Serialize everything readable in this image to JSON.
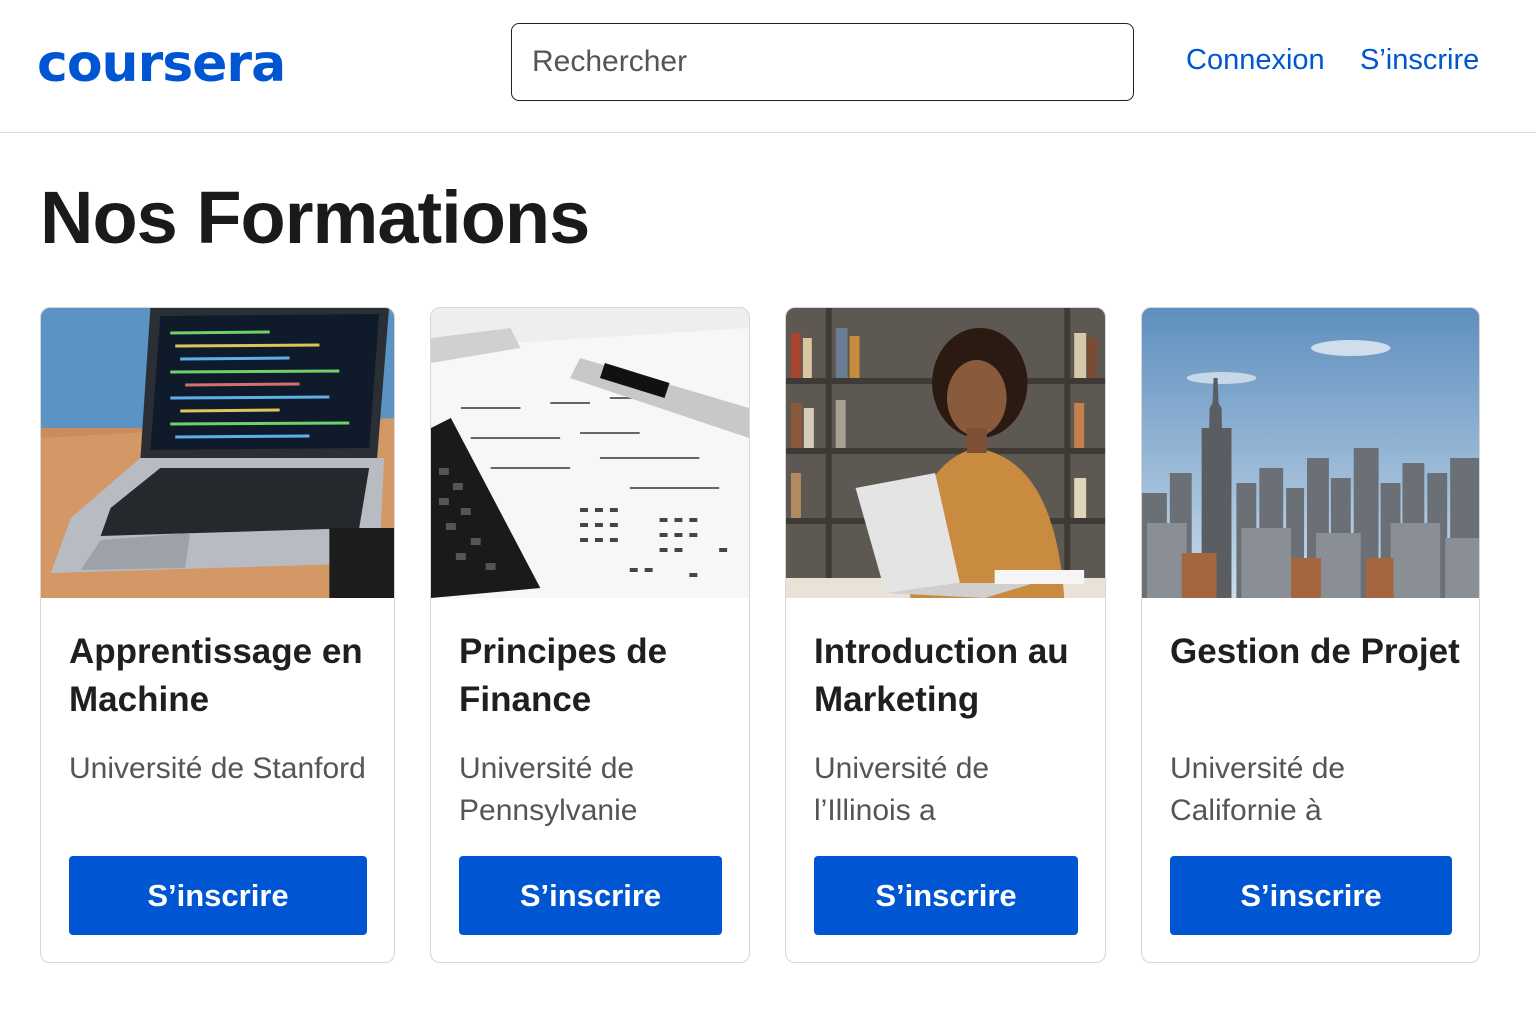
{
  "header": {
    "logo": "coursera",
    "search_placeholder": "Rechercher",
    "login": "Connexion",
    "signup": "S’inscrire"
  },
  "main": {
    "title": "Nos Formations",
    "courses": [
      {
        "title": "Apprentissage en Machine",
        "university": "Université de Stanford",
        "button": "S’inscrire",
        "image": "laptop-code-image"
      },
      {
        "title": "Principes de Finance",
        "university": "Université de Pennsylvanie",
        "button": "S’inscrire",
        "image": "calculator-finance-image"
      },
      {
        "title": "Introduction au Marketing",
        "university": "Université de l’Illinois a",
        "button": "S’inscrire",
        "image": "woman-laptop-image"
      },
      {
        "title": "Gestion de Projet",
        "university": "Université de Californie à",
        "button": "S’inscrire",
        "image": "city-skyline-image"
      }
    ]
  },
  "colors": {
    "brand": "#0056d2",
    "text": "#1f1f1f",
    "muted": "#555555"
  }
}
